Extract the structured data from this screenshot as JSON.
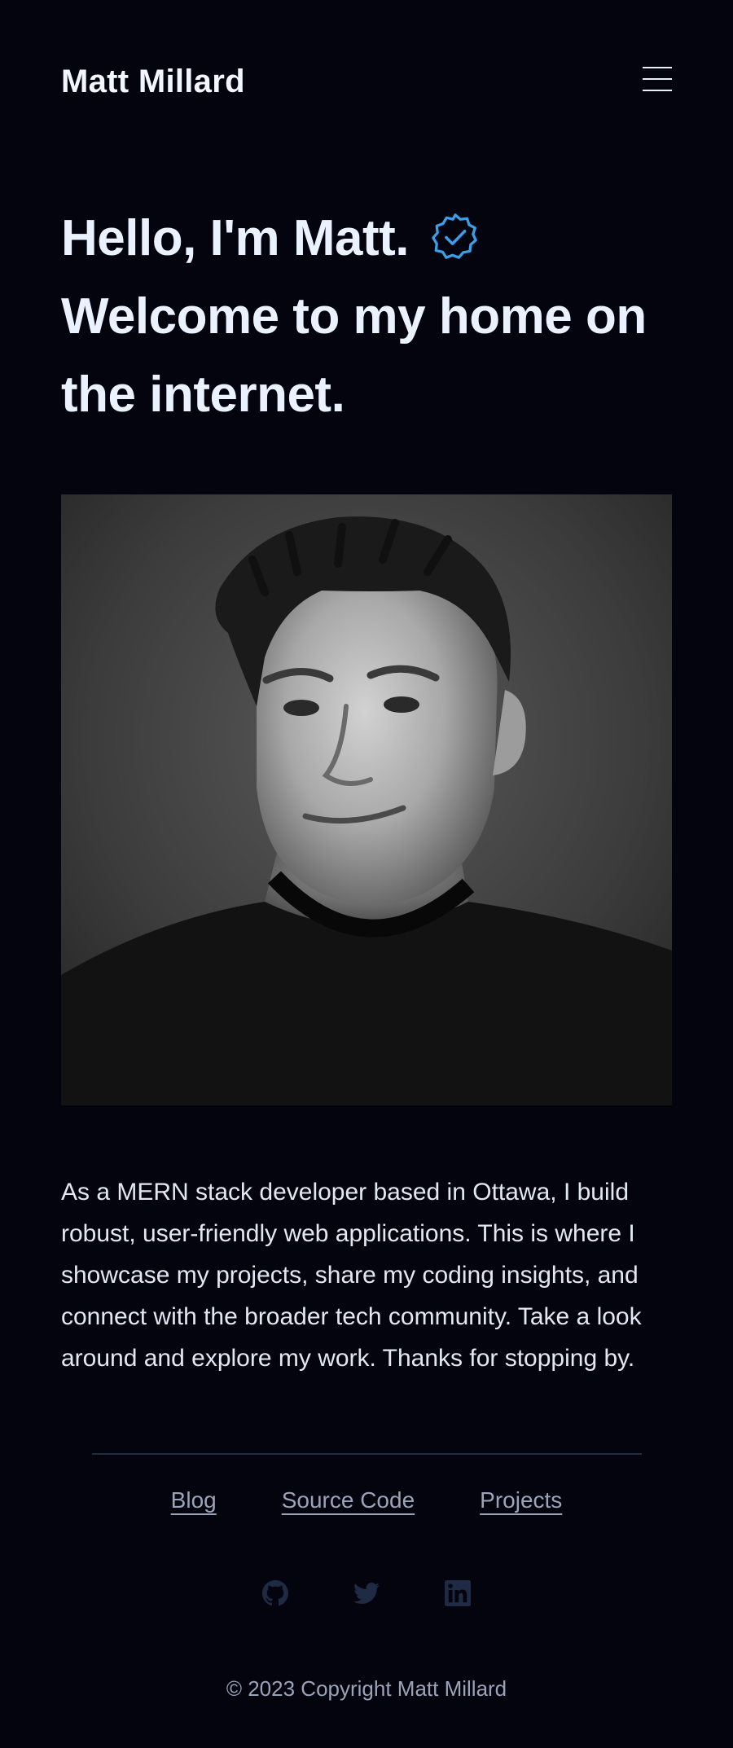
{
  "header": {
    "site_title": "Matt Millard",
    "menu_icon": "hamburger-menu-icon"
  },
  "hero": {
    "line1": "Hello, I'm Matt.",
    "line2": "Welcome to my home on",
    "line3": "the internet.",
    "badge_icon": "verified-badge-icon"
  },
  "portrait": {
    "description_icon": "portrait-photo"
  },
  "bio": {
    "text": "As a MERN stack developer based in Ottawa, I build robust, user-friendly web applications. This is where I showcase my projects, share my coding insights, and connect with the broader tech community. Take a look around and explore my work. Thanks for stopping by."
  },
  "footer": {
    "links": [
      {
        "label": "Blog"
      },
      {
        "label": "Source Code"
      },
      {
        "label": "Projects"
      }
    ],
    "social_icons": [
      "github-icon",
      "twitter-icon",
      "linkedin-icon"
    ],
    "copyright": "© 2023 Copyright Matt Millard"
  },
  "colors": {
    "background": "#04040f",
    "heading": "#eaf2ff",
    "accent": "#3b9ee6",
    "muted": "#9aa3b8",
    "social_icon": "#1f2a44"
  }
}
